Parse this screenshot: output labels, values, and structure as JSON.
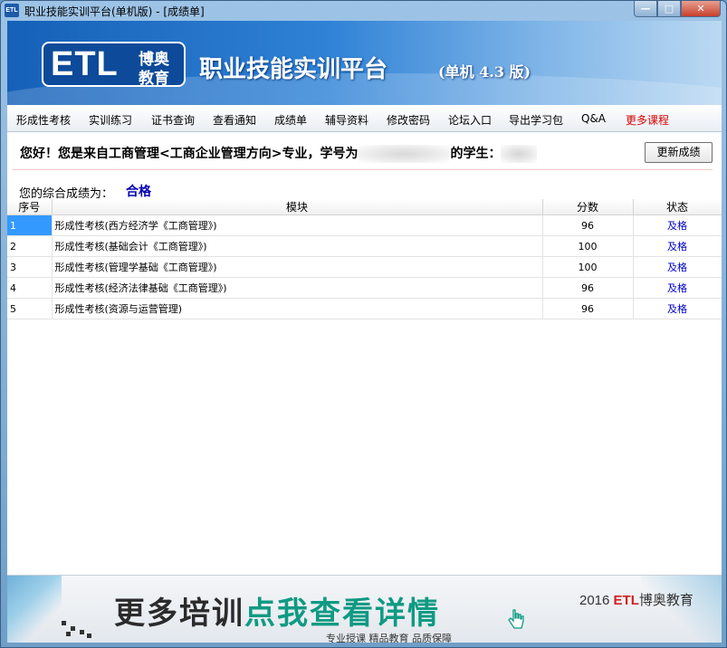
{
  "window": {
    "title": "职业技能实训平台(单机版) - [成绩单]",
    "icon_text": "ETL",
    "min_glyph": "—",
    "max_glyph": "□",
    "close_glyph": "✕"
  },
  "banner": {
    "logo_text": "ETL",
    "logo_cn_1": "博奥",
    "logo_cn_2": "教育",
    "title": "职业技能实训平台",
    "edition": "(单机 4.3 版)"
  },
  "menu": [
    {
      "label": "形成性考核"
    },
    {
      "label": "实训练习"
    },
    {
      "label": "证书查询"
    },
    {
      "label": "查看通知"
    },
    {
      "label": "成绩单"
    },
    {
      "label": "辅导资料"
    },
    {
      "label": "修改密码"
    },
    {
      "label": "论坛入口"
    },
    {
      "label": "导出学习包"
    },
    {
      "label": "Q&A"
    },
    {
      "label": "更多课程"
    }
  ],
  "greeting": {
    "part1": "您好！您是来自工商管理<工商企业管理方向>专业，学号为",
    "part2": "的学生："
  },
  "refresh_button": "更新成绩",
  "overall": {
    "label": "您的综合成绩为：",
    "value": "合格"
  },
  "table": {
    "columns": [
      "序号",
      "模块",
      "分数",
      "状态"
    ],
    "rows": [
      {
        "index": "1",
        "module": "形成性考核(西方经济学《工商管理》)",
        "score": "96",
        "status": "及格"
      },
      {
        "index": "2",
        "module": "形成性考核(基础会计《工商管理》)",
        "score": "100",
        "status": "及格"
      },
      {
        "index": "3",
        "module": "形成性考核(管理学基础《工商管理》)",
        "score": "100",
        "status": "及格"
      },
      {
        "index": "4",
        "module": "形成性考核(经济法律基础《工商管理》)",
        "score": "96",
        "status": "及格"
      },
      {
        "index": "5",
        "module": "形成性考核(资源与运营管理)",
        "score": "96",
        "status": "及格"
      }
    ]
  },
  "footer": {
    "promo_part1": "更多培训",
    "promo_part2": "点我查看详情",
    "copyright_year": "2016",
    "copyright_brand": "ETL",
    "copyright_name": "博奥教育",
    "slogan": "专业授课  精品教育  品质保障"
  }
}
